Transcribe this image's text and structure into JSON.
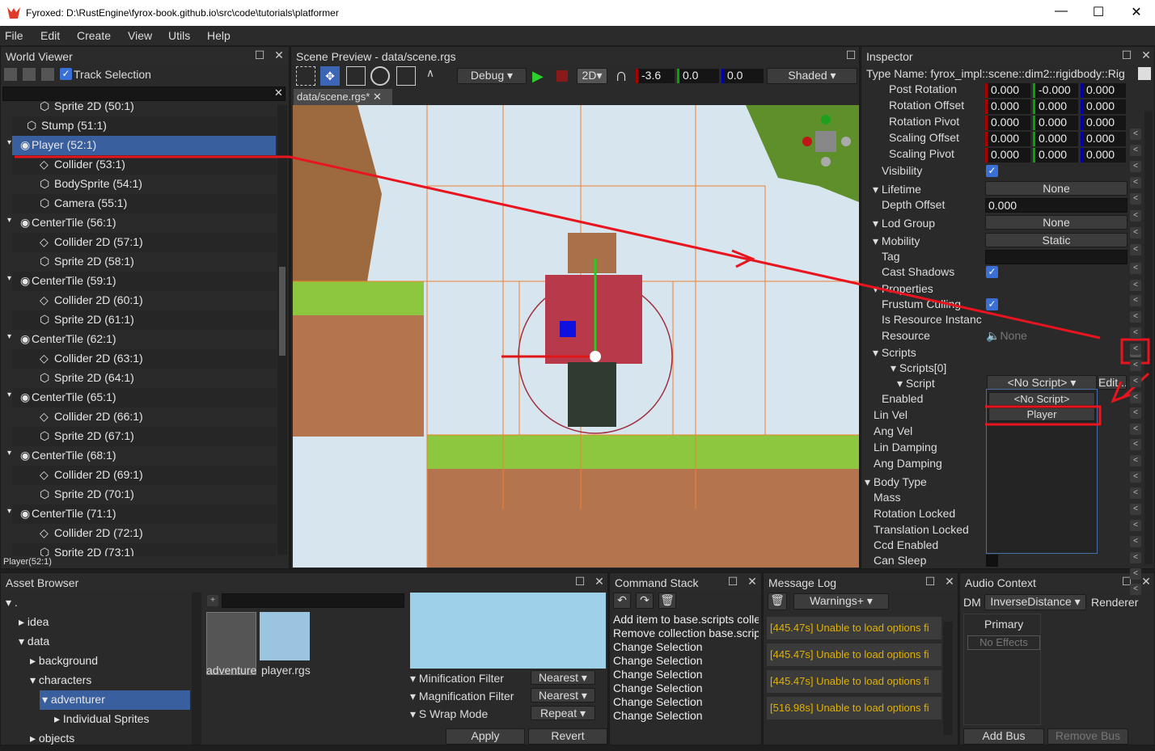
{
  "title": "Fyroxed: D:\\RustEngine\\fyrox-book.github.io\\src\\code\\tutorials\\platformer",
  "menu": [
    "File",
    "Edit",
    "Create",
    "View",
    "Utils",
    "Help"
  ],
  "world": {
    "title": "World Viewer",
    "track": "Track Selection",
    "status": "Player(52:1)",
    "rows": [
      {
        "label": "Sprite 2D (50:1)",
        "icon": "cube-icon"
      },
      {
        "label": "Stump (51:1)",
        "icon": "cube-icon"
      },
      {
        "label": "Player (52:1)",
        "icon": "rigid-body-icon"
      },
      {
        "label": "Collider (53:1)",
        "icon": "collider-icon"
      },
      {
        "label": "BodySprite (54:1)",
        "icon": "cube-icon"
      },
      {
        "label": "Camera (55:1)",
        "icon": "cube-icon"
      },
      {
        "label": "CenterTile (56:1)",
        "icon": "rigid-body-icon"
      },
      {
        "label": "Collider 2D (57:1)",
        "icon": "collider-icon"
      },
      {
        "label": "Sprite 2D (58:1)",
        "icon": "cube-icon"
      },
      {
        "label": "CenterTile (59:1)",
        "icon": "rigid-body-icon"
      },
      {
        "label": "Collider 2D (60:1)",
        "icon": "collider-icon"
      },
      {
        "label": "Sprite 2D (61:1)",
        "icon": "cube-icon"
      },
      {
        "label": "CenterTile (62:1)",
        "icon": "rigid-body-icon"
      },
      {
        "label": "Collider 2D (63:1)",
        "icon": "collider-icon"
      },
      {
        "label": "Sprite 2D (64:1)",
        "icon": "cube-icon"
      },
      {
        "label": "CenterTile (65:1)",
        "icon": "rigid-body-icon"
      },
      {
        "label": "Collider 2D (66:1)",
        "icon": "collider-icon"
      },
      {
        "label": "Sprite 2D (67:1)",
        "icon": "cube-icon"
      },
      {
        "label": "CenterTile (68:1)",
        "icon": "rigid-body-icon"
      },
      {
        "label": "Collider 2D (69:1)",
        "icon": "collider-icon"
      },
      {
        "label": "Sprite 2D (70:1)",
        "icon": "cube-icon"
      },
      {
        "label": "CenterTile (71:1)",
        "icon": "rigid-body-icon"
      },
      {
        "label": "Collider 2D (72:1)",
        "icon": "collider-icon"
      },
      {
        "label": "Sprite 2D (73:1)",
        "icon": "cube-icon"
      }
    ]
  },
  "scene": {
    "title": "Scene Preview - data/scene.rgs",
    "tab": "data/scene.rgs*",
    "debug": "Debug",
    "mode2d": "2D",
    "x": "-3.6",
    "y": "0.0",
    "z": "0.0",
    "shading": "Shaded"
  },
  "inspector": {
    "title": "Inspector",
    "type_name": "Type Name: fyrox_impl::scene::dim2::rigidbody::Rig",
    "vec_rows": [
      {
        "label": "Post Rotation",
        "v": [
          "0.000",
          "-0.000",
          "0.000"
        ]
      },
      {
        "label": "Rotation Offset",
        "v": [
          "0.000",
          "0.000",
          "0.000"
        ]
      },
      {
        "label": "Rotation Pivot",
        "v": [
          "0.000",
          "0.000",
          "0.000"
        ]
      },
      {
        "label": "Scaling Offset",
        "v": [
          "0.000",
          "0.000",
          "0.000"
        ]
      },
      {
        "label": "Scaling Pivot",
        "v": [
          "0.000",
          "0.000",
          "0.000"
        ]
      }
    ],
    "visibility": "Visibility",
    "lifetime": "Lifetime",
    "lifetime_val": "None",
    "depth_offset": "Depth Offset",
    "depth_val": "0.000",
    "lod_group": "Lod Group",
    "lod_val": "None",
    "mobility": "Mobility",
    "mobility_val": "Static",
    "tag": "Tag",
    "cast_shadows": "Cast Shadows",
    "properties": "Properties",
    "frustum": "Frustum Culling",
    "is_resource": "Is Resource Instanc",
    "resource": "Resource",
    "resource_val": "None",
    "scripts": "Scripts",
    "scripts0": "Scripts[0]",
    "script": "Script",
    "script_val": "<No Script>",
    "edit": "Edit...",
    "enabled": "Enabled",
    "lin_vel": "Lin Vel",
    "ang_vel": "Ang Vel",
    "lin_damp": "Lin Damping",
    "ang_damp": "Ang Damping",
    "body_type": "Body Type",
    "mass": "Mass",
    "rot_locked": "Rotation Locked",
    "trans_locked": "Translation Locked",
    "ccd": "Ccd Enabled",
    "can_sleep": "Can Sleep",
    "dropdown": [
      "<No Script>",
      "Player"
    ]
  },
  "assets": {
    "title": "Asset Browser",
    "tree": [
      ".",
      "idea",
      "data",
      "background",
      "characters",
      "adventurer",
      "Individual Sprites",
      "objects"
    ],
    "files": [
      "adventure",
      "player.rgs"
    ],
    "props": [
      {
        "label": "Minification Filter",
        "val": "Nearest"
      },
      {
        "label": "Magnification Filter",
        "val": "Nearest"
      },
      {
        "label": "S Wrap Mode",
        "val": "Repeat"
      }
    ],
    "apply": "Apply",
    "revert": "Revert"
  },
  "commands": {
    "title": "Command Stack",
    "items": [
      "Add item to base.scripts colle",
      "Remove collection base.scrip",
      "Change Selection",
      "Change Selection",
      "Change Selection",
      "Change Selection",
      "Change Selection",
      "Change Selection"
    ]
  },
  "log": {
    "title": "Message Log",
    "filter": "Warnings+",
    "items": [
      "[445.47s] Unable to load options fi",
      "[445.47s] Unable to load options fi",
      "[445.47s] Unable to load options fi",
      "[516.98s] Unable to load options fi"
    ]
  },
  "audio": {
    "title": "Audio Context",
    "dm": "DM",
    "dm_val": "InverseDistance",
    "renderer": "Renderer",
    "primary": "Primary",
    "no_effects": "No Effects",
    "add_bus": "Add Bus",
    "remove_bus": "Remove Bus"
  }
}
